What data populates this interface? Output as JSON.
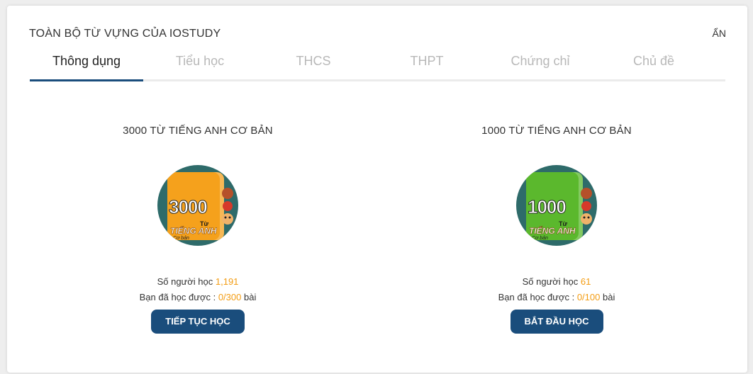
{
  "header": {
    "title": "TOÀN BỘ TỪ VỰNG CỦA IOSTUDY",
    "hide_label": "ẨN"
  },
  "tabs": [
    {
      "label": "Thông dụng",
      "active": true
    },
    {
      "label": "Tiểu học",
      "active": false
    },
    {
      "label": "THCS",
      "active": false
    },
    {
      "label": "THPT",
      "active": false
    },
    {
      "label": "Chứng chỉ",
      "active": false
    },
    {
      "label": "Chủ đề",
      "active": false
    }
  ],
  "courses": [
    {
      "title": "3000 TỪ TIẾNG ANH CƠ BẢN",
      "cover": {
        "number": "3000",
        "tu": "Từ",
        "tieng_anh": "TIẾNG ANH",
        "co_ban": "Cơ bản",
        "circle_color": "#2e6b6a",
        "book_color": "#f5a11c"
      },
      "learners_label": "Số người học",
      "learners_count": "1,191",
      "progress_label": "Bạn đã học được :",
      "progress_value": "0/300",
      "progress_unit": "bài",
      "button_label": "TIẾP TỤC HỌC"
    },
    {
      "title": "1000 TỪ TIẾNG ANH CƠ BẢN",
      "cover": {
        "number": "1000",
        "tu": "Từ",
        "tieng_anh": "TIẾNG ANH",
        "co_ban": "Cơ bản",
        "circle_color": "#2e6b6a",
        "book_color": "#5bb82d"
      },
      "learners_label": "Số người học",
      "learners_count": "61",
      "progress_label": "Bạn đã học được :",
      "progress_value": "0/100",
      "progress_unit": "bài",
      "button_label": "BẮT ĐẦU HỌC"
    }
  ],
  "colors": {
    "primary": "#1a4d7c",
    "highlight": "#f39c12"
  }
}
